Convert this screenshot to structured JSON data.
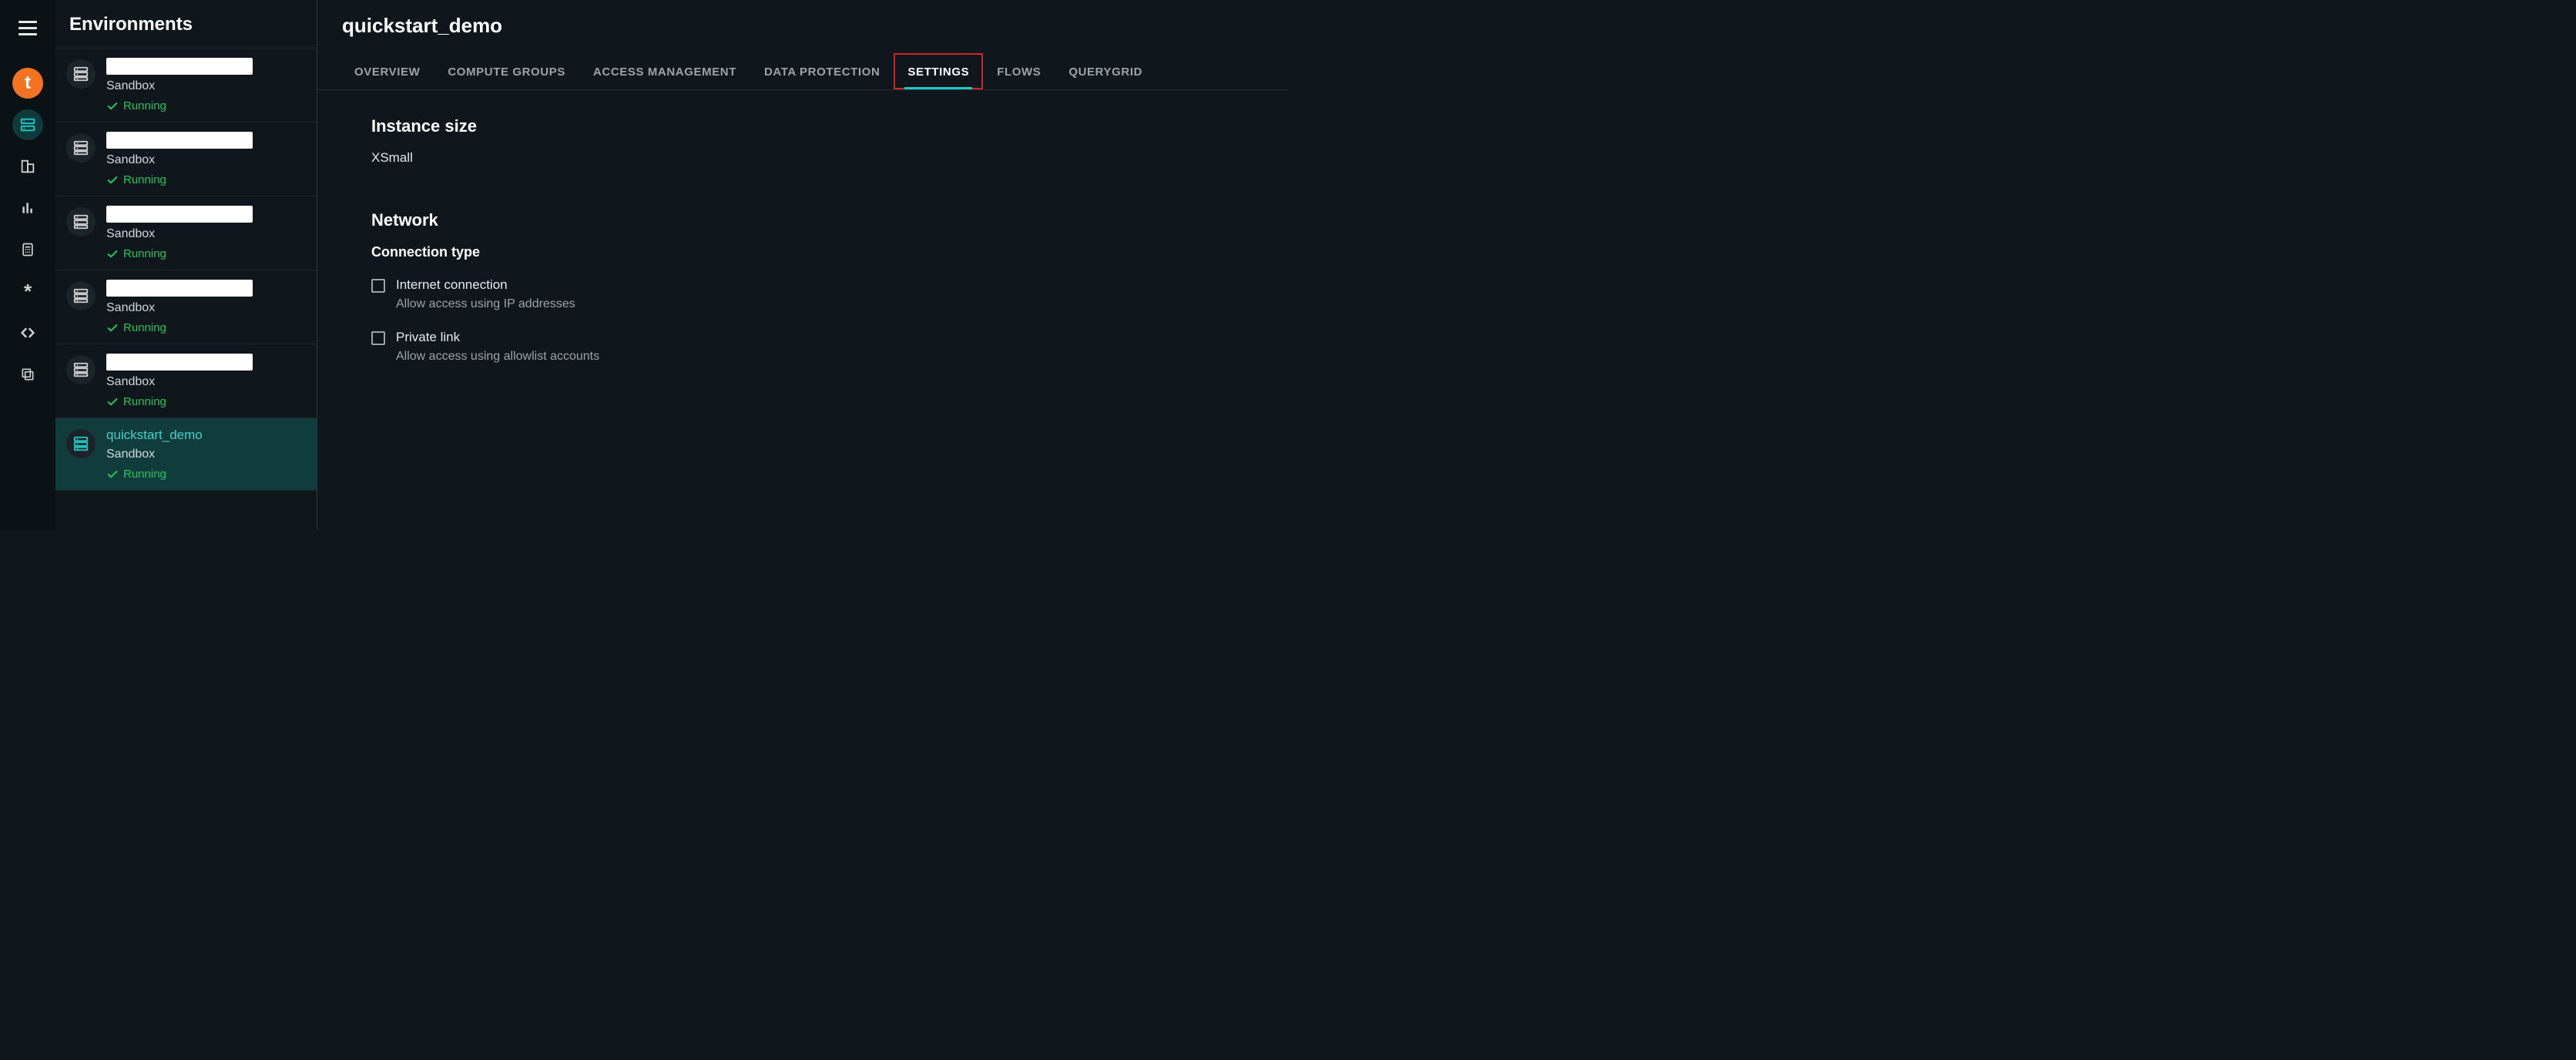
{
  "rail": {
    "logo_letter": "t"
  },
  "sidebar": {
    "title": "Environments",
    "items": [
      {
        "name": "",
        "masked": true,
        "type": "Sandbox",
        "status": "Running",
        "selected": false
      },
      {
        "name": "",
        "masked": true,
        "type": "Sandbox",
        "status": "Running",
        "selected": false
      },
      {
        "name": "",
        "masked": true,
        "type": "Sandbox",
        "status": "Running",
        "selected": false
      },
      {
        "name": "",
        "masked": true,
        "type": "Sandbox",
        "status": "Running",
        "selected": false
      },
      {
        "name": "",
        "masked": true,
        "type": "Sandbox",
        "status": "Running",
        "selected": false
      },
      {
        "name": "quickstart_demo",
        "masked": false,
        "type": "Sandbox",
        "status": "Running",
        "selected": true
      }
    ]
  },
  "main": {
    "title": "quickstart_demo",
    "tabs": [
      {
        "label": "OVERVIEW",
        "active": false
      },
      {
        "label": "COMPUTE GROUPS",
        "active": false
      },
      {
        "label": "ACCESS MANAGEMENT",
        "active": false
      },
      {
        "label": "DATA PROTECTION",
        "active": false
      },
      {
        "label": "SETTINGS",
        "active": true,
        "highlighted": true
      },
      {
        "label": "FLOWS",
        "active": false
      },
      {
        "label": "QUERYGRID",
        "active": false
      }
    ],
    "instance_size": {
      "heading": "Instance size",
      "value": "XSmall"
    },
    "network": {
      "heading": "Network",
      "connection_type_label": "Connection type",
      "options": [
        {
          "label": "Internet connection",
          "desc": "Allow access using IP addresses",
          "checked": false
        },
        {
          "label": "Private link",
          "desc": "Allow access using allowlist accounts",
          "checked": false
        }
      ]
    }
  }
}
